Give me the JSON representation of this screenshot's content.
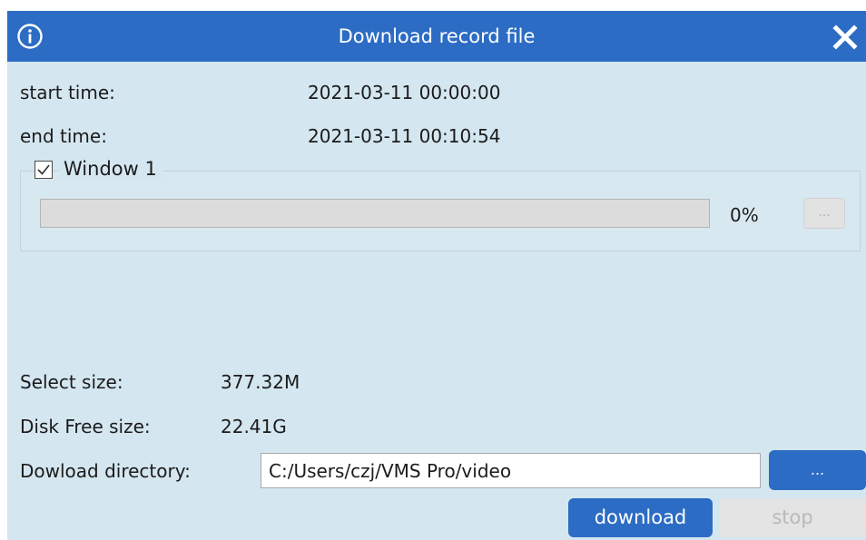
{
  "window": {
    "title": "Download record file",
    "info_icon": "info-icon",
    "close_icon": "close-icon"
  },
  "times": {
    "start_label": "start time:",
    "start_value": "2021-03-11 00:00:00",
    "end_label": "end time:",
    "end_value": "2021-03-11 00:10:54"
  },
  "channel": {
    "checked": true,
    "label": "Window 1",
    "progress_fraction": 0,
    "progress_text": "0%",
    "more_label": "..."
  },
  "sizes": {
    "select_label": "Select size:",
    "select_value": "377.32M",
    "free_label": "Disk Free size:",
    "free_value": "22.41G"
  },
  "directory": {
    "label": "Dowload directory:",
    "value": "C:/Users/czj/VMS Pro/video",
    "browse_label": "..."
  },
  "actions": {
    "download_label": "download",
    "stop_label": "stop"
  },
  "colors": {
    "accent": "#2c6cc4",
    "panel_bg": "#d4e6f0",
    "disabled_bg": "#e4e4e4"
  }
}
